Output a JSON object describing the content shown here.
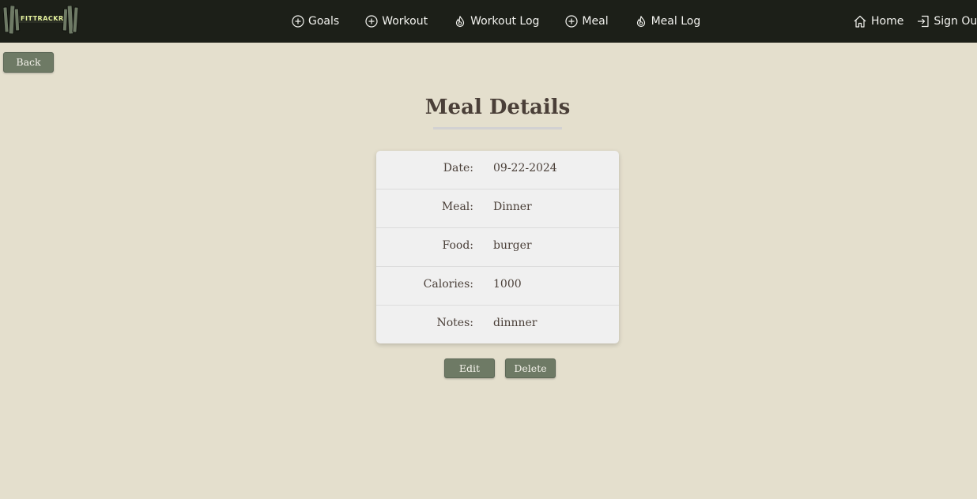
{
  "brand": {
    "logo_text": "FITTRACKR"
  },
  "nav": {
    "items": [
      {
        "label": "Goals",
        "icon": "plus-circle-icon"
      },
      {
        "label": "Workout",
        "icon": "plus-circle-icon"
      },
      {
        "label": "Workout Log",
        "icon": "flame-icon"
      },
      {
        "label": "Meal",
        "icon": "plus-circle-icon"
      },
      {
        "label": "Meal Log",
        "icon": "flame-icon"
      }
    ],
    "right": [
      {
        "label": "Home",
        "icon": "home-icon"
      },
      {
        "label": "Sign Out",
        "icon": "sign-out-icon"
      }
    ]
  },
  "back_label": "Back",
  "page_title": "Meal Details",
  "details": {
    "rows": [
      {
        "label": "Date:",
        "value": "09-22-2024"
      },
      {
        "label": "Meal:",
        "value": "Dinner"
      },
      {
        "label": "Food:",
        "value": "burger"
      },
      {
        "label": "Calories:",
        "value": "1000"
      },
      {
        "label": "Notes:",
        "value": "dinnner"
      }
    ]
  },
  "actions": {
    "edit_label": "Edit",
    "delete_label": "Delete"
  },
  "colors": {
    "nav_bg": "#1c1f18",
    "page_bg": "#e4dfcd",
    "button_bg": "#6e7a65",
    "card_bg": "#f0f0f0",
    "logo_accent": "#e8f5a0"
  }
}
